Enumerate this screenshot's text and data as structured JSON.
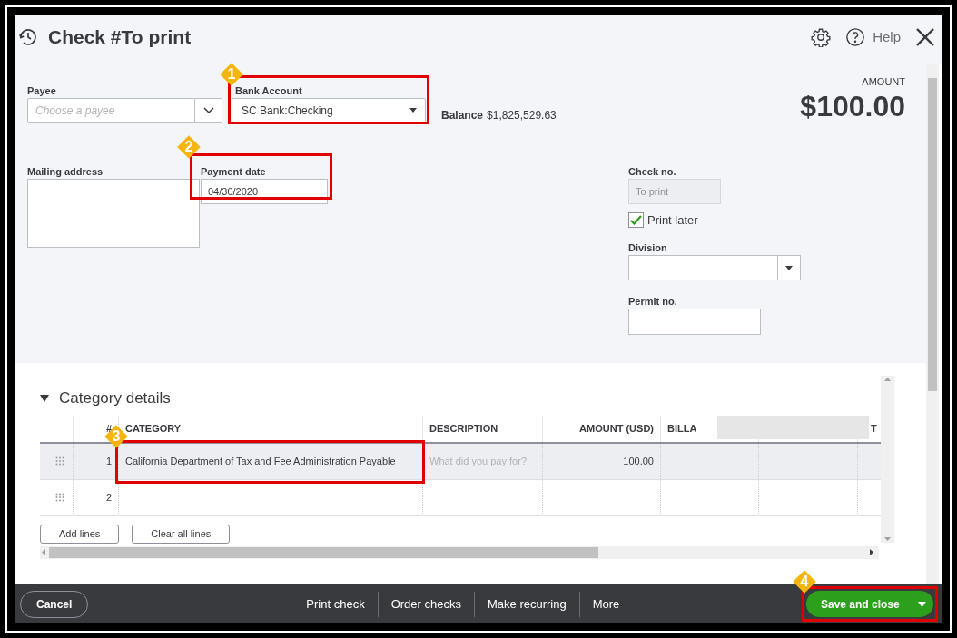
{
  "title": "Check #To print",
  "help": "Help",
  "payee": {
    "label": "Payee",
    "placeholder": "Choose a payee"
  },
  "bank_account": {
    "label": "Bank Account",
    "value": "SC Bank:Checking",
    "balance_label": "Balance",
    "balance": "$1,825,529.63",
    "callout": "1"
  },
  "amount": {
    "label": "AMOUNT",
    "value": "$100.00"
  },
  "mailing_address": {
    "label": "Mailing address"
  },
  "payment_date": {
    "label": "Payment date",
    "value": "04/30/2020",
    "callout": "2"
  },
  "check_no": {
    "label": "Check no.",
    "value": "To print",
    "disabled": true
  },
  "print_later": {
    "label": "Print later",
    "checked": true
  },
  "division": {
    "label": "Division"
  },
  "permit_no": {
    "label": "Permit no."
  },
  "category_details": {
    "title": "Category details",
    "expanded": true,
    "columns": [
      "#",
      "CATEGORY",
      "DESCRIPTION",
      "AMOUNT (USD)",
      "BILLA",
      "T"
    ],
    "rows": [
      {
        "number": "1",
        "category": "California Department of Tax and Fee Administration Payable",
        "description_placeholder": "What did you pay for?",
        "amount": "100.00",
        "selected": true,
        "callout": "3"
      },
      {
        "number": "2",
        "selected": false
      }
    ],
    "buttons": [
      "Add lines",
      "Clear all lines"
    ]
  },
  "footer": {
    "cancel": "Cancel",
    "actions": [
      "Print check",
      "Order checks",
      "Make recurring",
      "More"
    ],
    "save": "Save and close",
    "save_callout": "4"
  }
}
